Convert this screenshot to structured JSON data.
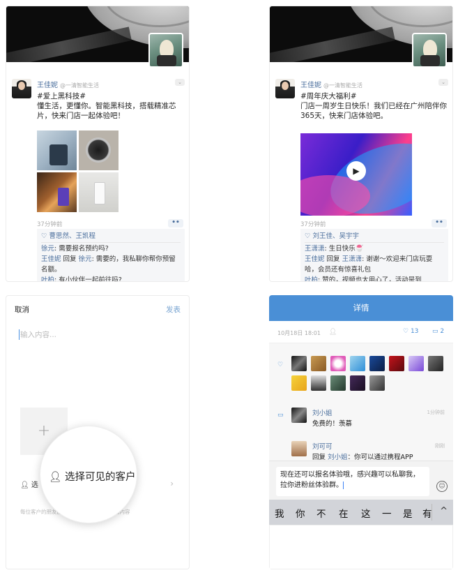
{
  "panel1": {
    "author": "王佳妮",
    "source": "@一清智能生活",
    "text": "#爱上黑科技#\n懂生活，更懂你。智能黑科技，搭载精准芯片，快来门店一起体验吧！",
    "time": "37分钟前",
    "more_label": "••",
    "likes_line": "♡ 曹思然、王凯程",
    "comments": [
      {
        "name": "徐元",
        "text": ": 需要报名预约吗?"
      },
      {
        "name": "王佳妮",
        "mid": " 回复 ",
        "to": "徐元",
        "text": ": 需要的，我私聊你帮你预留名额。"
      },
      {
        "name": "叶柏",
        "text": ": 有小伙伴一起前往吗?"
      }
    ]
  },
  "panel2": {
    "author": "王佳妮",
    "source": "@一清智能生活",
    "text": "#周年庆大福利#\n门店一周岁生日快乐！我们已经在广州陪伴你365天，快来门店体验吧。",
    "time": "37分钟前",
    "more_label": "••",
    "play_icon": "▶",
    "likes_line": "♡ 刘王佳、吴宇宇",
    "comments": [
      {
        "name": "王潇潇",
        "text": ": 生日快乐🍧"
      },
      {
        "name": "王佳妮",
        "mid": " 回复 ",
        "to": "王潇潇",
        "text": ": 谢谢～欢迎来门店玩耍哈，会员还有惊喜礼包"
      },
      {
        "name": "叶柏",
        "text": ": 赞的，视频也太用心了，活动是到"
      }
    ]
  },
  "editor": {
    "cancel": "取消",
    "publish": "发表",
    "placeholder": "输入内容...",
    "add_symbol": "+",
    "visible_label_partial": "选",
    "visible_label": "选择可见的客户",
    "arrow": "›",
    "hint": "每位客户的朋友圈，每天最多展示你发表的内容"
  },
  "detail": {
    "title": "详情",
    "datetime": "10月18日 18:01",
    "pin_icon": "person-icon",
    "likes": "13",
    "comments_count": "2",
    "comments": [
      {
        "name": "刘小姐",
        "text": "免费的！羡慕",
        "time": "1分钟前"
      },
      {
        "name": "刘可可",
        "reply_prefix": "回复 ",
        "reply_to": "刘小姐",
        "text": "：你可以通过携程APP",
        "time": "刚刚"
      }
    ],
    "input_text": "现在还可以报名体验哦，感兴趣可以私聊我，拉你进粉丝体验群。",
    "smile_icon": "☺",
    "candidates": [
      "我",
      "你",
      "不",
      "在",
      "这",
      "一",
      "是",
      "有"
    ],
    "collapse_icon": "^"
  },
  "colors": {
    "accent": "#4a8fd6",
    "link": "#4a6e9c"
  }
}
